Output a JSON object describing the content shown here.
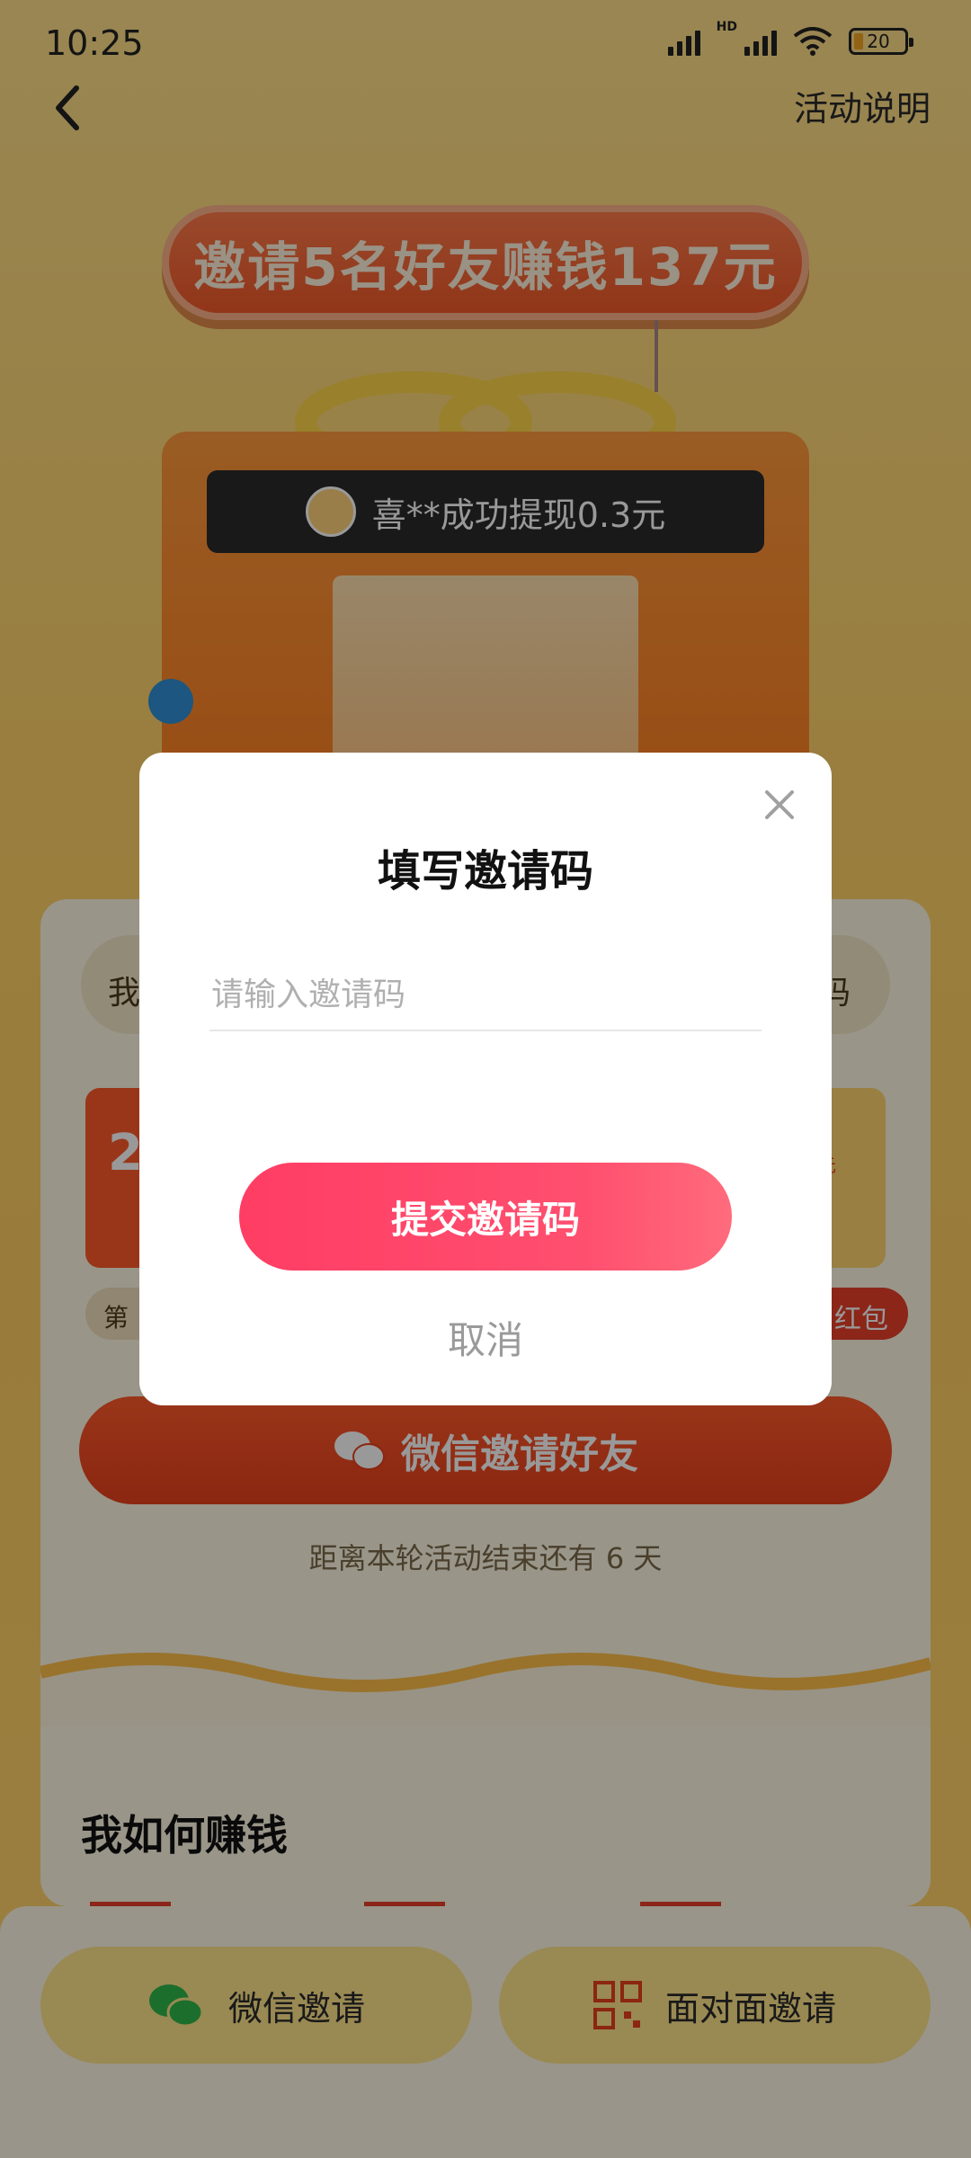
{
  "status_bar": {
    "time": "10:25",
    "network_badge": "HD",
    "battery": "20"
  },
  "nav": {
    "rules_link": "活动说明"
  },
  "banner": {
    "headline": "邀请5名好友赚钱137元"
  },
  "ticker": {
    "message": "喜**成功提现0.3元"
  },
  "invite_card": {
    "my_code_prefix": "我",
    "my_code_suffix": "码",
    "reward_left_value": "2",
    "reward_right_unit": "元",
    "step_left_label": "第",
    "step_right_label": "红包",
    "wechat_invite_button": "微信邀请好友",
    "countdown": "距离本轮活动结束还有 6 天"
  },
  "howto": {
    "title": "我如何赚钱"
  },
  "bottom_bar": {
    "wechat_invite": "微信邀请",
    "face_to_face_invite": "面对面邀请"
  },
  "dialog": {
    "title": "填写邀请码",
    "input_placeholder": "请输入邀请码",
    "input_value": "",
    "submit_button": "提交邀请码",
    "cancel_button": "取消"
  },
  "icons": {
    "back": "back-chevron-icon",
    "close": "close-icon",
    "wechat": "wechat-icon",
    "qr_code": "qr-code-icon",
    "signal": "signal-icon",
    "wifi": "wifi-icon",
    "battery": "battery-icon",
    "share": "share-icon"
  },
  "colors": {
    "accent_pink": "#ff4466",
    "accent_orange": "#e8401c",
    "overlay": "rgba(0,0,0,0.40)"
  }
}
